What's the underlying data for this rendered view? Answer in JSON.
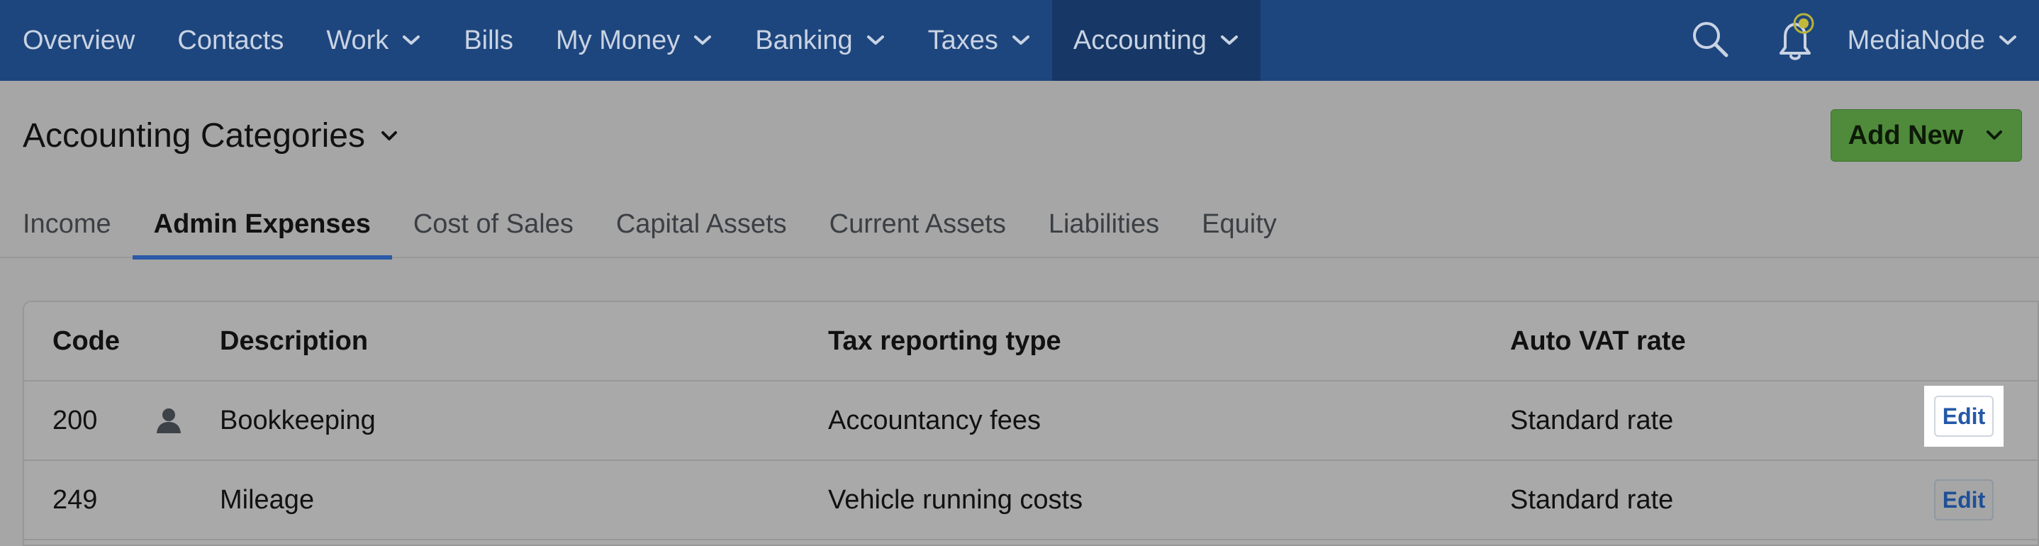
{
  "nav": {
    "items": [
      {
        "label": "Overview",
        "has_dropdown": false,
        "active": false
      },
      {
        "label": "Contacts",
        "has_dropdown": false,
        "active": false
      },
      {
        "label": "Work",
        "has_dropdown": true,
        "active": false
      },
      {
        "label": "Bills",
        "has_dropdown": false,
        "active": false
      },
      {
        "label": "My Money",
        "has_dropdown": true,
        "active": false
      },
      {
        "label": "Banking",
        "has_dropdown": true,
        "active": false
      },
      {
        "label": "Taxes",
        "has_dropdown": true,
        "active": false
      },
      {
        "label": "Accounting",
        "has_dropdown": true,
        "active": true
      }
    ],
    "user_name": "MediaNode"
  },
  "page": {
    "title": "Accounting Categories",
    "add_new_label": "Add New"
  },
  "tabs": [
    {
      "label": "Income",
      "active": false
    },
    {
      "label": "Admin Expenses",
      "active": true
    },
    {
      "label": "Cost of Sales",
      "active": false
    },
    {
      "label": "Capital Assets",
      "active": false
    },
    {
      "label": "Current Assets",
      "active": false
    },
    {
      "label": "Liabilities",
      "active": false
    },
    {
      "label": "Equity",
      "active": false
    }
  ],
  "table": {
    "headers": {
      "code": "Code",
      "description": "Description",
      "tax_type": "Tax reporting type",
      "vat": "Auto VAT rate"
    },
    "rows": [
      {
        "code": "200",
        "has_user_icon": true,
        "description": "Bookkeeping",
        "tax_type": "Accountancy fees",
        "vat": "Standard rate",
        "edit": "Edit"
      },
      {
        "code": "249",
        "has_user_icon": false,
        "description": "Mileage",
        "tax_type": "Vehicle running costs",
        "vat": "Standard rate",
        "edit": "Edit"
      }
    ]
  },
  "colors": {
    "nav_bg": "#1e467e",
    "nav_active_bg": "#173866",
    "accent_tab": "#2a5aa8",
    "add_new_bg": "#4f8b3b",
    "overlay_bg": "#a6a6a6"
  }
}
